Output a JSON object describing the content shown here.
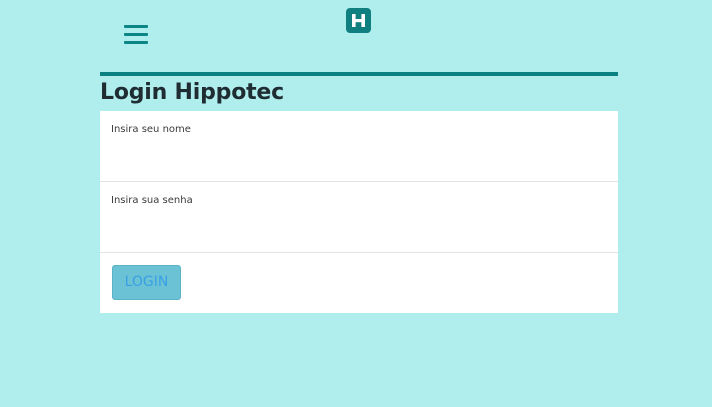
{
  "header": {
    "menu_icon": "hamburger-menu-icon",
    "logo_letter": "H",
    "colors": {
      "background": "#b0eeee",
      "accent": "#0b8080",
      "logo": "#0f7f7f"
    }
  },
  "main": {
    "title": "Login Hippotec",
    "form": {
      "username_label": "Insira seu nome",
      "username_value": "",
      "password_label": "Insira sua senha",
      "password_value": "",
      "login_label": "LOGIN",
      "button_color": "#6ac2d4",
      "button_text_color": "#3aa0e6"
    }
  }
}
